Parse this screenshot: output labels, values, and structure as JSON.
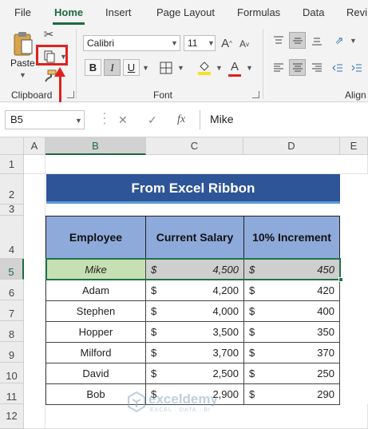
{
  "ribbon_tabs": [
    "File",
    "Home",
    "Insert",
    "Page Layout",
    "Formulas",
    "Data",
    "Revi"
  ],
  "clipboard": {
    "paste_label": "Paste",
    "group_label": "Clipboard"
  },
  "font": {
    "family": "Calibri",
    "size": "11",
    "group_label": "Font",
    "bold": "B",
    "italic": "I",
    "underline": "U"
  },
  "alignment": {
    "group_label": "Align"
  },
  "formula_bar": {
    "name_box": "B5",
    "fx": "fx",
    "formula": "Mike"
  },
  "columns": [
    "A",
    "B",
    "C",
    "D",
    "E"
  ],
  "rows": [
    "1",
    "2",
    "3",
    "4",
    "5",
    "6",
    "7",
    "8",
    "9",
    "10",
    "11",
    "12"
  ],
  "sheet": {
    "title": "From Excel Ribbon",
    "headers": [
      "Employee",
      "Current Salary",
      "10% Increment"
    ],
    "currency": "$",
    "records": [
      {
        "name": "Mike",
        "salary": "4,500",
        "increment": "450"
      },
      {
        "name": "Adam",
        "salary": "4,200",
        "increment": "420"
      },
      {
        "name": "Stephen",
        "salary": "4,000",
        "increment": "400"
      },
      {
        "name": "Hopper",
        "salary": "3,500",
        "increment": "350"
      },
      {
        "name": "Milford",
        "salary": "3,700",
        "increment": "370"
      },
      {
        "name": "David",
        "salary": "2,500",
        "increment": "250"
      },
      {
        "name": "Bob",
        "salary": "2,900",
        "increment": "290"
      }
    ]
  },
  "watermark": {
    "name": "exceldemy",
    "tagline": "EXCEL · DATA · BI"
  },
  "colors": {
    "accent": "#1d6b3d",
    "banner": "#2e5597",
    "header_fill": "#8eaadb",
    "selected_fill": "#c6e0b4",
    "highlight": "#e02020"
  }
}
